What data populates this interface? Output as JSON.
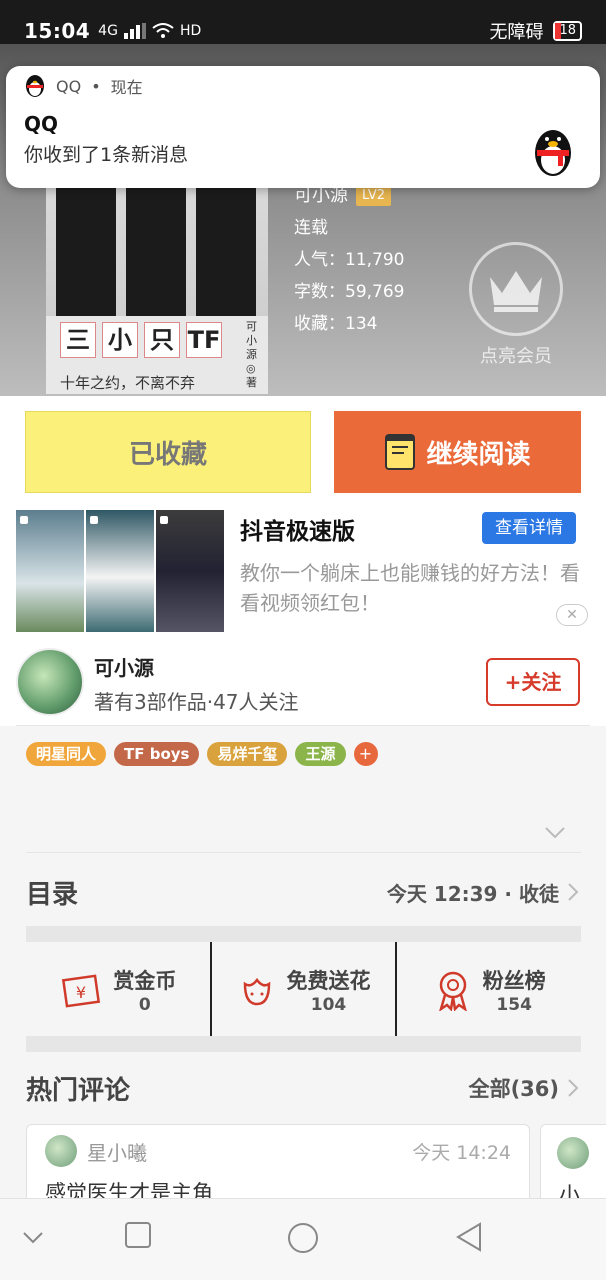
{
  "status_bar": {
    "time": "15:04",
    "network": "4G",
    "accessibility": "无障碍",
    "battery": "18"
  },
  "notification": {
    "app": "QQ",
    "when": "现在",
    "separator": "•",
    "title": "QQ",
    "body": "你收到了1条新消息"
  },
  "book": {
    "cover_title": [
      "三",
      "小",
      "只",
      "TF"
    ],
    "cover_subtitle": "十年之约，不离不弃",
    "cover_author": "可小源◎著",
    "author": "可小源",
    "level": "LV2",
    "status": "连载",
    "popularity": "人气：11,790",
    "words": "字数：59,769",
    "favorites": "收藏：134",
    "vip_label": "点亮会员"
  },
  "actions": {
    "favorited": "已收藏",
    "continue_read": "继续阅读"
  },
  "ad": {
    "app_name": "抖音极速版",
    "detail_button": "查看详情",
    "description": "教你一个躺床上也能赚钱的好方法！看看视频领红包！",
    "close": "✕"
  },
  "author_card": {
    "name": "可小源",
    "meta": "著有3部作品·47人关注",
    "follow": "+关注"
  },
  "tags": [
    {
      "label": "明星同人",
      "color": "#f0a63a"
    },
    {
      "label": "TF boys",
      "color": "#c4684a"
    },
    {
      "label": "易烊千玺",
      "color": "#d9a23c"
    },
    {
      "label": "王源",
      "color": "#8bb54a"
    }
  ],
  "catalog": {
    "title": "目录",
    "latest": "今天 12:39 · 收徒"
  },
  "stats": [
    {
      "label": "赏金币",
      "value": "0",
      "icon": "coin-envelope-icon"
    },
    {
      "label": "免费送花",
      "value": "104",
      "icon": "flower-icon"
    },
    {
      "label": "粉丝榜",
      "value": "154",
      "icon": "medal-icon"
    }
  ],
  "comments": {
    "title": "热门评论",
    "all": "全部(36)",
    "first": {
      "user": "星小曦",
      "time": "今天 14:24",
      "text": "感觉医生才是主角"
    },
    "second_preview": "小"
  },
  "colors": {
    "accent_orange": "#ea6a3a",
    "fav_yellow": "#fbf17a",
    "follow_red": "#d63a2a",
    "detail_blue": "#2b78e4"
  }
}
